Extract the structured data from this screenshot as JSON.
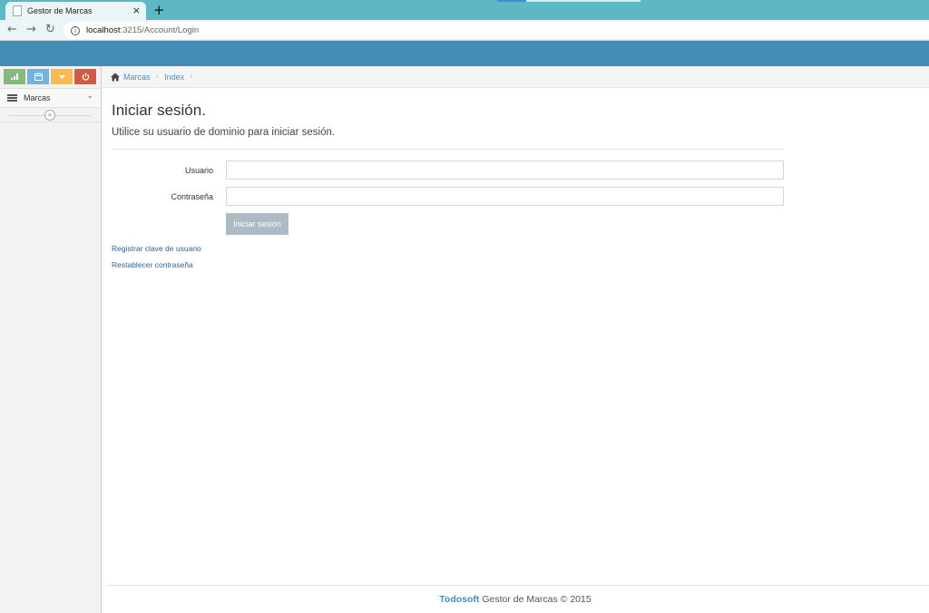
{
  "browser": {
    "tab_title": "Gestor de Marcas",
    "tab_close": "×",
    "new_tab": "+",
    "url_host": "localhost",
    "url_path": ":3215/Account/Login"
  },
  "sidebar": {
    "shortcuts": [
      {
        "icon": "signal-icon",
        "color": "#87b87f"
      },
      {
        "icon": "calendar-icon",
        "color": "#6fb3e0"
      },
      {
        "icon": "caret-down-icon",
        "color": "#ffb752"
      },
      {
        "icon": "power-icon",
        "color": "#d15b47"
      }
    ],
    "nav_item_label": "Marcas",
    "collapse_icon": "double-chevron-left-icon"
  },
  "breadcrumb": {
    "items": [
      "Marcas",
      "Index"
    ]
  },
  "login": {
    "title": "Iniciar sesión.",
    "subtitle": "Utilice su usuario de dominio para iniciar sesión.",
    "username_label": "Usuario",
    "username_value": "",
    "password_label": "Contraseña",
    "password_value": "",
    "submit_label": "Iniciar sesión",
    "register_link": "Registrar clave de usuario",
    "reset_link": "Restablecer contraseña"
  },
  "footer": {
    "brand": "Todosoft",
    "text": " Gestor de Marcas © 2015"
  },
  "colors": {
    "header": "#438eb9",
    "tabbar": "#5db8c4",
    "link": "#4c8fbd",
    "submit": "#abbac3"
  }
}
